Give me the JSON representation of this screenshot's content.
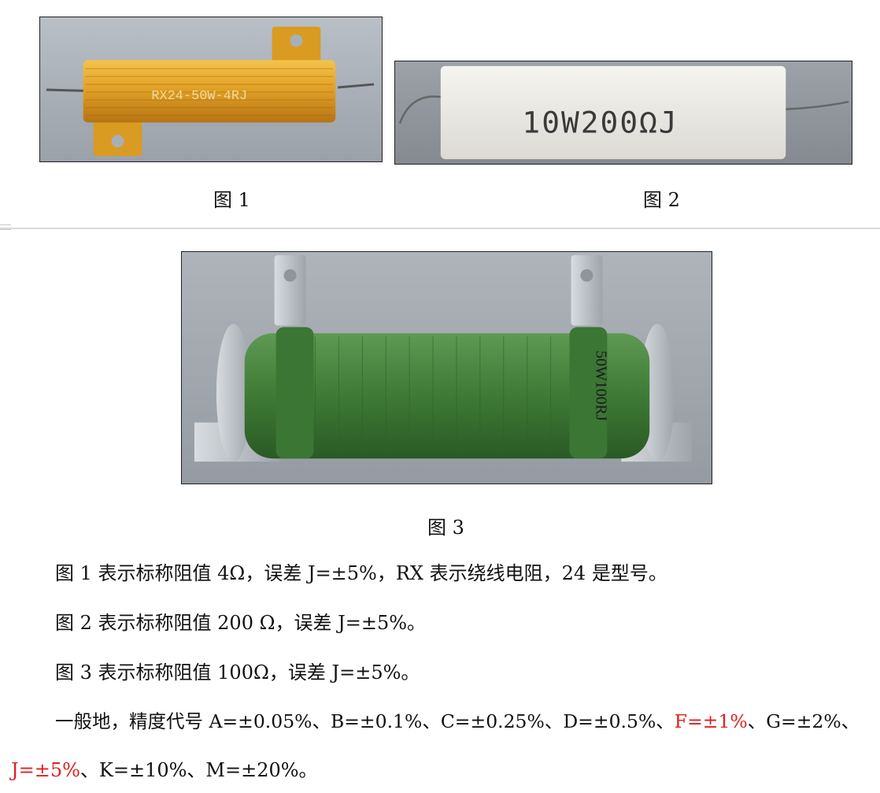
{
  "figures": [
    {
      "caption": "图 1",
      "marking": "RX24-50W-4RJ"
    },
    {
      "caption": "图 2",
      "marking": "10W200ΩJ"
    },
    {
      "caption": "图 3",
      "marking": "50W100RJ"
    }
  ],
  "paragraphs": {
    "p1": "图 1 表示标称阻值 4Ω，误差 J=±5%，RX 表示绕线电阻，24 是型号。",
    "p2": "图 2 表示标称阻值 200 Ω，误差 J=±5%。",
    "p3": "图 3 表示标称阻值 100Ω，误差 J=±5%。",
    "p4": {
      "part1": "一般地，精度代号 A=±0.05%、B=±0.1%、C=±0.25%、D=±0.5%、",
      "red1": "F=±1%",
      "part2": "、G=±2%、",
      "red2": "J=±5%",
      "part3": "、K=±10%、M=±20%。"
    }
  },
  "colors": {
    "highlight": "#e02020",
    "separator": "#d9d9d9"
  }
}
